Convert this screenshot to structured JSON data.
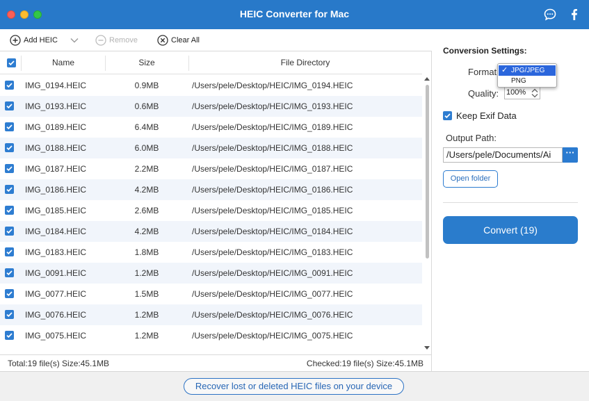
{
  "app": {
    "title": "HEIC Converter for Mac",
    "accent_color": "#2879c9",
    "icons": [
      "chat-icon",
      "facebook-icon"
    ]
  },
  "toolbar": {
    "add_label": "Add HEIC",
    "remove_label": "Remove",
    "clear_label": "Clear All"
  },
  "table": {
    "columns": [
      "Name",
      "Size",
      "File Directory"
    ],
    "rows": [
      {
        "name": "IMG_0194.HEIC",
        "size": "0.9MB",
        "dir": "/Users/pele/Desktop/HEIC/IMG_0194.HEIC"
      },
      {
        "name": "IMG_0193.HEIC",
        "size": "0.6MB",
        "dir": "/Users/pele/Desktop/HEIC/IMG_0193.HEIC"
      },
      {
        "name": "IMG_0189.HEIC",
        "size": "6.4MB",
        "dir": "/Users/pele/Desktop/HEIC/IMG_0189.HEIC"
      },
      {
        "name": "IMG_0188.HEIC",
        "size": "6.0MB",
        "dir": "/Users/pele/Desktop/HEIC/IMG_0188.HEIC"
      },
      {
        "name": "IMG_0187.HEIC",
        "size": "2.2MB",
        "dir": "/Users/pele/Desktop/HEIC/IMG_0187.HEIC"
      },
      {
        "name": "IMG_0186.HEIC",
        "size": "4.2MB",
        "dir": "/Users/pele/Desktop/HEIC/IMG_0186.HEIC"
      },
      {
        "name": "IMG_0185.HEIC",
        "size": "2.6MB",
        "dir": "/Users/pele/Desktop/HEIC/IMG_0185.HEIC"
      },
      {
        "name": "IMG_0184.HEIC",
        "size": "4.2MB",
        "dir": "/Users/pele/Desktop/HEIC/IMG_0184.HEIC"
      },
      {
        "name": "IMG_0183.HEIC",
        "size": "1.8MB",
        "dir": "/Users/pele/Desktop/HEIC/IMG_0183.HEIC"
      },
      {
        "name": "IMG_0091.HEIC",
        "size": "1.2MB",
        "dir": "/Users/pele/Desktop/HEIC/IMG_0091.HEIC"
      },
      {
        "name": "IMG_0077.HEIC",
        "size": "1.5MB",
        "dir": "/Users/pele/Desktop/HEIC/IMG_0077.HEIC"
      },
      {
        "name": "IMG_0076.HEIC",
        "size": "1.2MB",
        "dir": "/Users/pele/Desktop/HEIC/IMG_0076.HEIC"
      },
      {
        "name": "IMG_0075.HEIC",
        "size": "1.2MB",
        "dir": "/Users/pele/Desktop/HEIC/IMG_0075.HEIC"
      }
    ]
  },
  "status": {
    "total": "Total:19 file(s) Size:45.1MB",
    "checked": "Checked:19 file(s) Size:45.1MB"
  },
  "settings": {
    "heading": "Conversion Settings:",
    "format_label": "Format:",
    "format_options": [
      "JPG/JPEG",
      "PNG"
    ],
    "format_selected": "JPG/JPEG",
    "quality_label": "Quality:",
    "quality_value": "100%",
    "keep_exif_label": "Keep Exif Data",
    "keep_exif_checked": true,
    "output_label": "Output Path:",
    "output_value": "/Users/pele/Documents/Ai",
    "browse_label": "···",
    "open_folder_label": "Open folder",
    "convert_label": "Convert (19)"
  },
  "footer": {
    "recover_label": "Recover lost or deleted HEIC files on your device"
  }
}
